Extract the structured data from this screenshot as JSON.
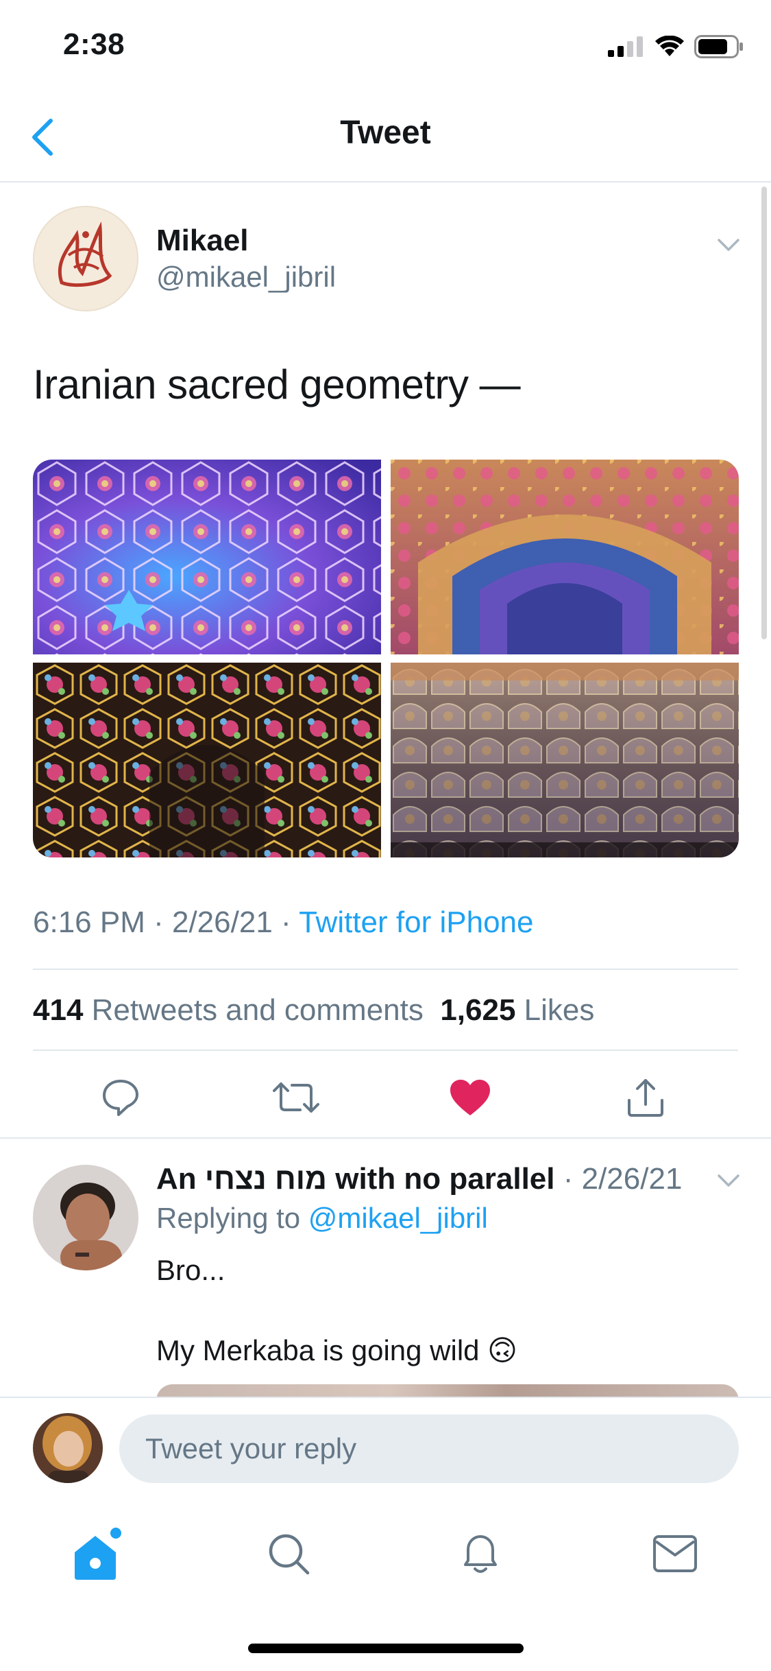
{
  "status_bar": {
    "time": "2:38"
  },
  "nav": {
    "title": "Tweet"
  },
  "tweet": {
    "author_name": "Mikael",
    "author_handle": "@mikael_jibril",
    "text": "Iranian sacred geometry —",
    "time": "6:16 PM",
    "date": "2/26/21",
    "source": "Twitter for iPhone",
    "retweets_count": "414",
    "retweets_label": "Retweets and comments",
    "likes_count": "1,625",
    "likes_label": "Likes",
    "liked": true
  },
  "reply": {
    "author_name": "An מוח נצחי with no parallel",
    "date": "2/26/21",
    "replying_to_label": "Replying to",
    "replying_to_handle": "@mikael_jibril",
    "line1": "Bro...",
    "line2": "My Merkaba is going wild 🙃"
  },
  "compose": {
    "placeholder": "Tweet your reply"
  },
  "colors": {
    "accent": "#1da1f2",
    "like": "#e0245e",
    "muted": "#657786",
    "divider": "#e1e8ed"
  },
  "icons": [
    "back-chevron-icon",
    "signal-icon",
    "wifi-icon",
    "battery-icon",
    "chevron-down-icon",
    "reply-icon",
    "retweet-icon",
    "heart-icon",
    "share-icon",
    "home-icon",
    "search-icon",
    "bell-icon",
    "mail-icon"
  ]
}
